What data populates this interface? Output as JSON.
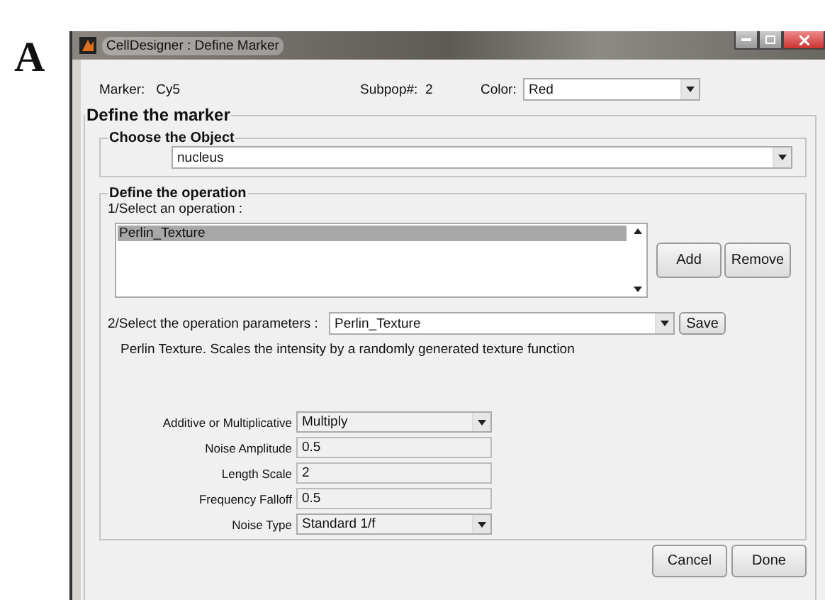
{
  "figure_label": "A",
  "window": {
    "title": "CellDesigner : Define Marker"
  },
  "header": {
    "marker_label": "Marker:",
    "marker_value": "Cy5",
    "subpop_label": "Subpop#:",
    "subpop_value": "2",
    "color_label": "Color:",
    "color_value": "Red"
  },
  "define_marker": {
    "title": "Define the marker",
    "choose_object": {
      "title": "Choose the Object",
      "value": "nucleus"
    },
    "operation": {
      "title": "Define the operation",
      "select_label": "1/Select an operation :",
      "operations": [
        {
          "label": "Perlin_Texture",
          "selected": true
        }
      ],
      "list_buttons": [
        "Add",
        "Remove"
      ],
      "params_label": "2/Select the operation parameters :",
      "params_value": "Perlin_Texture",
      "save_button": "Save",
      "description": "Perlin Texture. Scales the intensity by a randomly generated texture function",
      "parameters": [
        {
          "label": "Additive or Multiplicative",
          "value": "Multiply",
          "kind": "dropdown"
        },
        {
          "label": "Noise Amplitude",
          "value": "0.5",
          "kind": "text"
        },
        {
          "label": "Length Scale",
          "value": "2",
          "kind": "text"
        },
        {
          "label": "Frequency Falloff",
          "value": "0.5",
          "kind": "text"
        },
        {
          "label": "Noise Type",
          "value": "Standard 1/f",
          "kind": "dropdown"
        }
      ]
    }
  },
  "footer_buttons": [
    "Cancel",
    "Done"
  ]
}
